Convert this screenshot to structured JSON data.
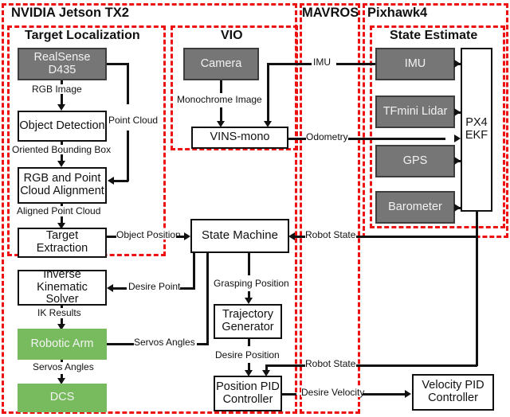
{
  "containers": {
    "jetson": {
      "label": "NVIDIA Jetson TX2"
    },
    "target_localization": {
      "label": "Target Localization"
    },
    "vio": {
      "label": "VIO"
    },
    "mavros": {
      "label": "MAVROS"
    },
    "pixhawk": {
      "label": "Pixhawk4"
    },
    "state_estimate": {
      "label": "State Estimate"
    }
  },
  "nodes": {
    "realsense": {
      "label": "RealSense D435",
      "style": "gray"
    },
    "object_detection": {
      "label": "Object Detection",
      "style": "white"
    },
    "rgb_point_cloud_alignment": {
      "label": "RGB and Point Cloud Alignment",
      "style": "white"
    },
    "target_extraction": {
      "label": "Target Extraction",
      "style": "white"
    },
    "inverse_kinematic_solver": {
      "label": "Inverse Kinematic Solver",
      "style": "white"
    },
    "robotic_arm": {
      "label": "Robotic Arm",
      "style": "green"
    },
    "dcs": {
      "label": "DCS",
      "style": "green"
    },
    "camera": {
      "label": "Camera",
      "style": "gray"
    },
    "vins_mono": {
      "label": "VINS-mono",
      "style": "white"
    },
    "state_machine": {
      "label": "State Machine",
      "style": "white"
    },
    "trajectory_generator": {
      "label": "Trajectory Generator",
      "style": "white"
    },
    "position_pid_controller": {
      "label": "Position PID Controller",
      "style": "white"
    },
    "velocity_pid_controller": {
      "label": "Velocity PID Controller",
      "style": "white"
    },
    "imu": {
      "label": "IMU",
      "style": "gray"
    },
    "tfmini_lidar": {
      "label": "TFmini Lidar",
      "style": "gray"
    },
    "gps": {
      "label": "GPS",
      "style": "gray"
    },
    "barometer": {
      "label": "Barometer",
      "style": "gray"
    },
    "px4_ekf": {
      "label": "PX4 EKF",
      "style": "white"
    }
  },
  "edge_labels": {
    "rgb_image": "RGB Image",
    "point_cloud": "Point Cloud",
    "oriented_bounding_box": "Oriented Bounding Box",
    "aligned_point_cloud": "Aligned Point Cloud",
    "object_position": "Object Position",
    "desire_point": "Desire Point",
    "ik_results": "IK Results",
    "servos_angles_arm": "Servos Angles",
    "servos_angles_dcs": "Servos Angles",
    "monochrome_image": "Monochrome Image",
    "imu": "IMU",
    "odometry": "Odometry",
    "robot_state_top": "Robot State",
    "robot_state_bottom": "Robot State",
    "grasping_position": "Grasping Position",
    "desire_position": "Desire Position",
    "desire_velocity": "Desire Velocity"
  },
  "colors": {
    "container_border": "#ee1111",
    "sensor_fill": "#767676",
    "actuator_fill": "#77bb5e",
    "line": "#111111"
  }
}
